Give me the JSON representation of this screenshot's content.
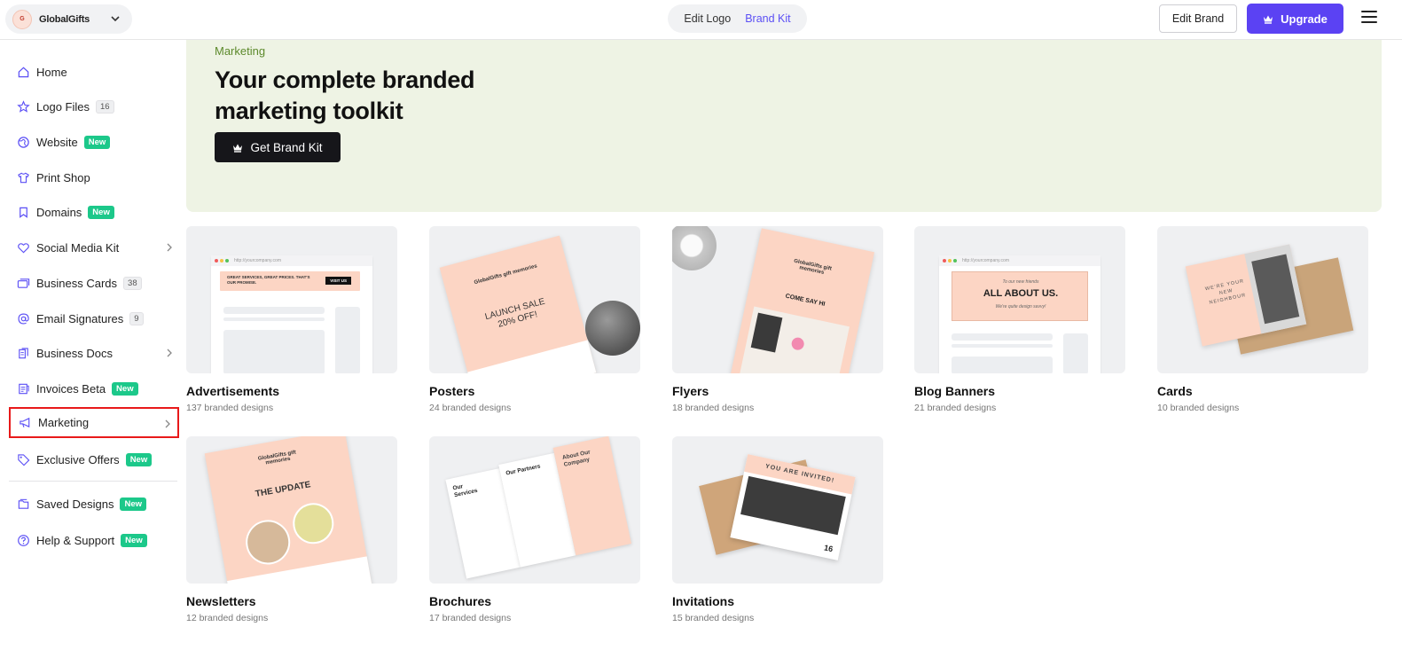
{
  "header": {
    "brand_name": "GlobalGifts",
    "tabs": {
      "edit_logo": "Edit Logo",
      "brand_kit": "Brand Kit"
    },
    "edit_brand_label": "Edit Brand",
    "upgrade_label": "Upgrade"
  },
  "sidebar": {
    "items": [
      {
        "label": "Home"
      },
      {
        "label": "Logo Files",
        "count": "16"
      },
      {
        "label": "Website",
        "badge": "New"
      },
      {
        "label": "Print Shop"
      },
      {
        "label": "Domains",
        "badge": "New"
      },
      {
        "label": "Social Media Kit"
      },
      {
        "label": "Business Cards",
        "count": "38"
      },
      {
        "label": "Email Signatures",
        "count": "9"
      },
      {
        "label": "Business Docs"
      },
      {
        "label": "Invoices Beta",
        "badge": "New"
      },
      {
        "label": "Marketing"
      },
      {
        "label": "Exclusive Offers",
        "badge": "New"
      },
      {
        "label": "Saved Designs",
        "badge": "New"
      },
      {
        "label": "Help & Support",
        "badge": "New"
      }
    ]
  },
  "hero": {
    "eyebrow": "Marketing",
    "title": "Your complete branded marketing toolkit",
    "cta_label": "Get Brand Kit"
  },
  "cards": [
    {
      "title": "Advertisements",
      "subtitle": "137 branded designs"
    },
    {
      "title": "Posters",
      "subtitle": "24 branded designs"
    },
    {
      "title": "Flyers",
      "subtitle": "18 branded designs"
    },
    {
      "title": "Blog Banners",
      "subtitle": "21 branded designs"
    },
    {
      "title": "Cards",
      "subtitle": "10 branded designs"
    },
    {
      "title": "Newsletters",
      "subtitle": "12 branded designs"
    },
    {
      "title": "Brochures",
      "subtitle": "17 branded designs"
    },
    {
      "title": "Invitations",
      "subtitle": "15 branded designs"
    }
  ],
  "thumb_text": {
    "url": "http://yourcompany.com",
    "ad_banner": "GREAT SERVICES, GREAT PRICES. THAT'S OUR PROMISE.",
    "ad_cta": "VISIT US",
    "poster_logo": "GlobalGifts gift memories",
    "poster_headline": "LAUNCH SALE 20% OFF!",
    "flyer_headline": "COME SAY HI",
    "blog_small": "To our new friends",
    "blog_headline": "ALL ABOUT US.",
    "blog_sub": "We're quite design savvy!",
    "card_text": "WE'RE YOUR NEW NEIGHBOUR",
    "news_headline": "THE UPDATE",
    "brochure_services": "Our Services",
    "brochure_partners": "Our Partners",
    "brochure_about": "About Our Company",
    "invite_headline": "YOU ARE INVITED!",
    "invite_day": "16"
  },
  "colors": {
    "accent": "#5b42f3",
    "link": "#5b4ff5",
    "new_badge": "#1cc88a",
    "hero_bg": "#eef3e4",
    "hero_eyebrow": "#5d8a2c",
    "peach": "#fcd5c4",
    "selected_outline": "#e8191a"
  }
}
